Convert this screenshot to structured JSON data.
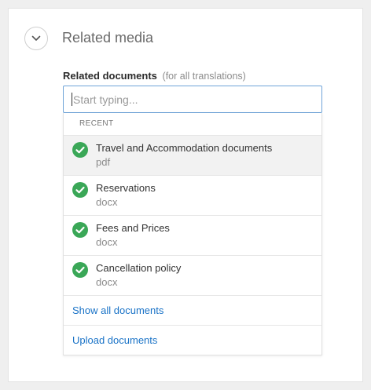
{
  "section": {
    "title": "Related media"
  },
  "field": {
    "label": "Related documents",
    "hint": "(for all translations)",
    "placeholder": "Start typing..."
  },
  "dropdown": {
    "header": "RECENT",
    "items": [
      {
        "name": "Travel and Accommodation documents",
        "ext": "pdf",
        "icon": "check-circle-icon"
      },
      {
        "name": "Reservations",
        "ext": "docx",
        "icon": "check-circle-icon"
      },
      {
        "name": "Fees and Prices",
        "ext": "docx",
        "icon": "check-circle-icon"
      },
      {
        "name": "Cancellation policy",
        "ext": "docx",
        "icon": "check-circle-icon"
      }
    ],
    "show_all": "Show all documents",
    "upload": "Upload documents"
  },
  "colors": {
    "check_green": "#3aa757",
    "link_blue": "#1a73c7",
    "focus_border": "#6fa4d8"
  }
}
